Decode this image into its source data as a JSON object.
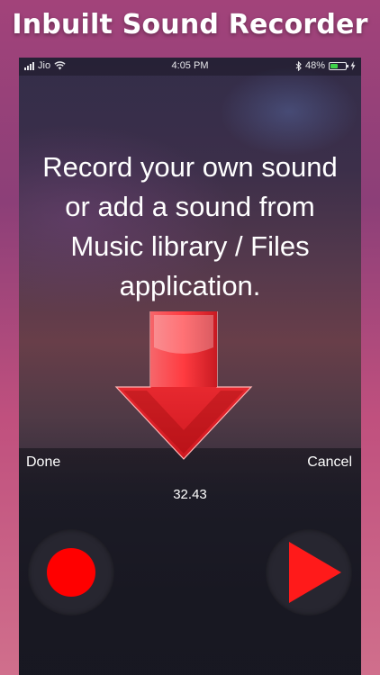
{
  "headline": "Inbuilt Sound Recorder",
  "status_bar": {
    "carrier": "Jio",
    "time": "4:05 PM",
    "battery": "48%",
    "battery_level": 0.48,
    "icons": [
      "signal-bars-icon",
      "wifi-icon",
      "bluetooth-icon",
      "battery-icon",
      "charging-icon"
    ]
  },
  "instructions": {
    "line1": "Record your own sound",
    "line2": "or add a sound from",
    "line3": "Music library / Files",
    "line4": "application."
  },
  "recorder": {
    "done_label": "Done",
    "cancel_label": "Cancel",
    "timer": "32.43",
    "record_icon": "record-icon",
    "play_icon": "play-icon"
  },
  "colors": {
    "record": "#ff0000",
    "play": "#ff1a1a",
    "arrow": "#e8232b",
    "battery": "#3fd24a"
  }
}
